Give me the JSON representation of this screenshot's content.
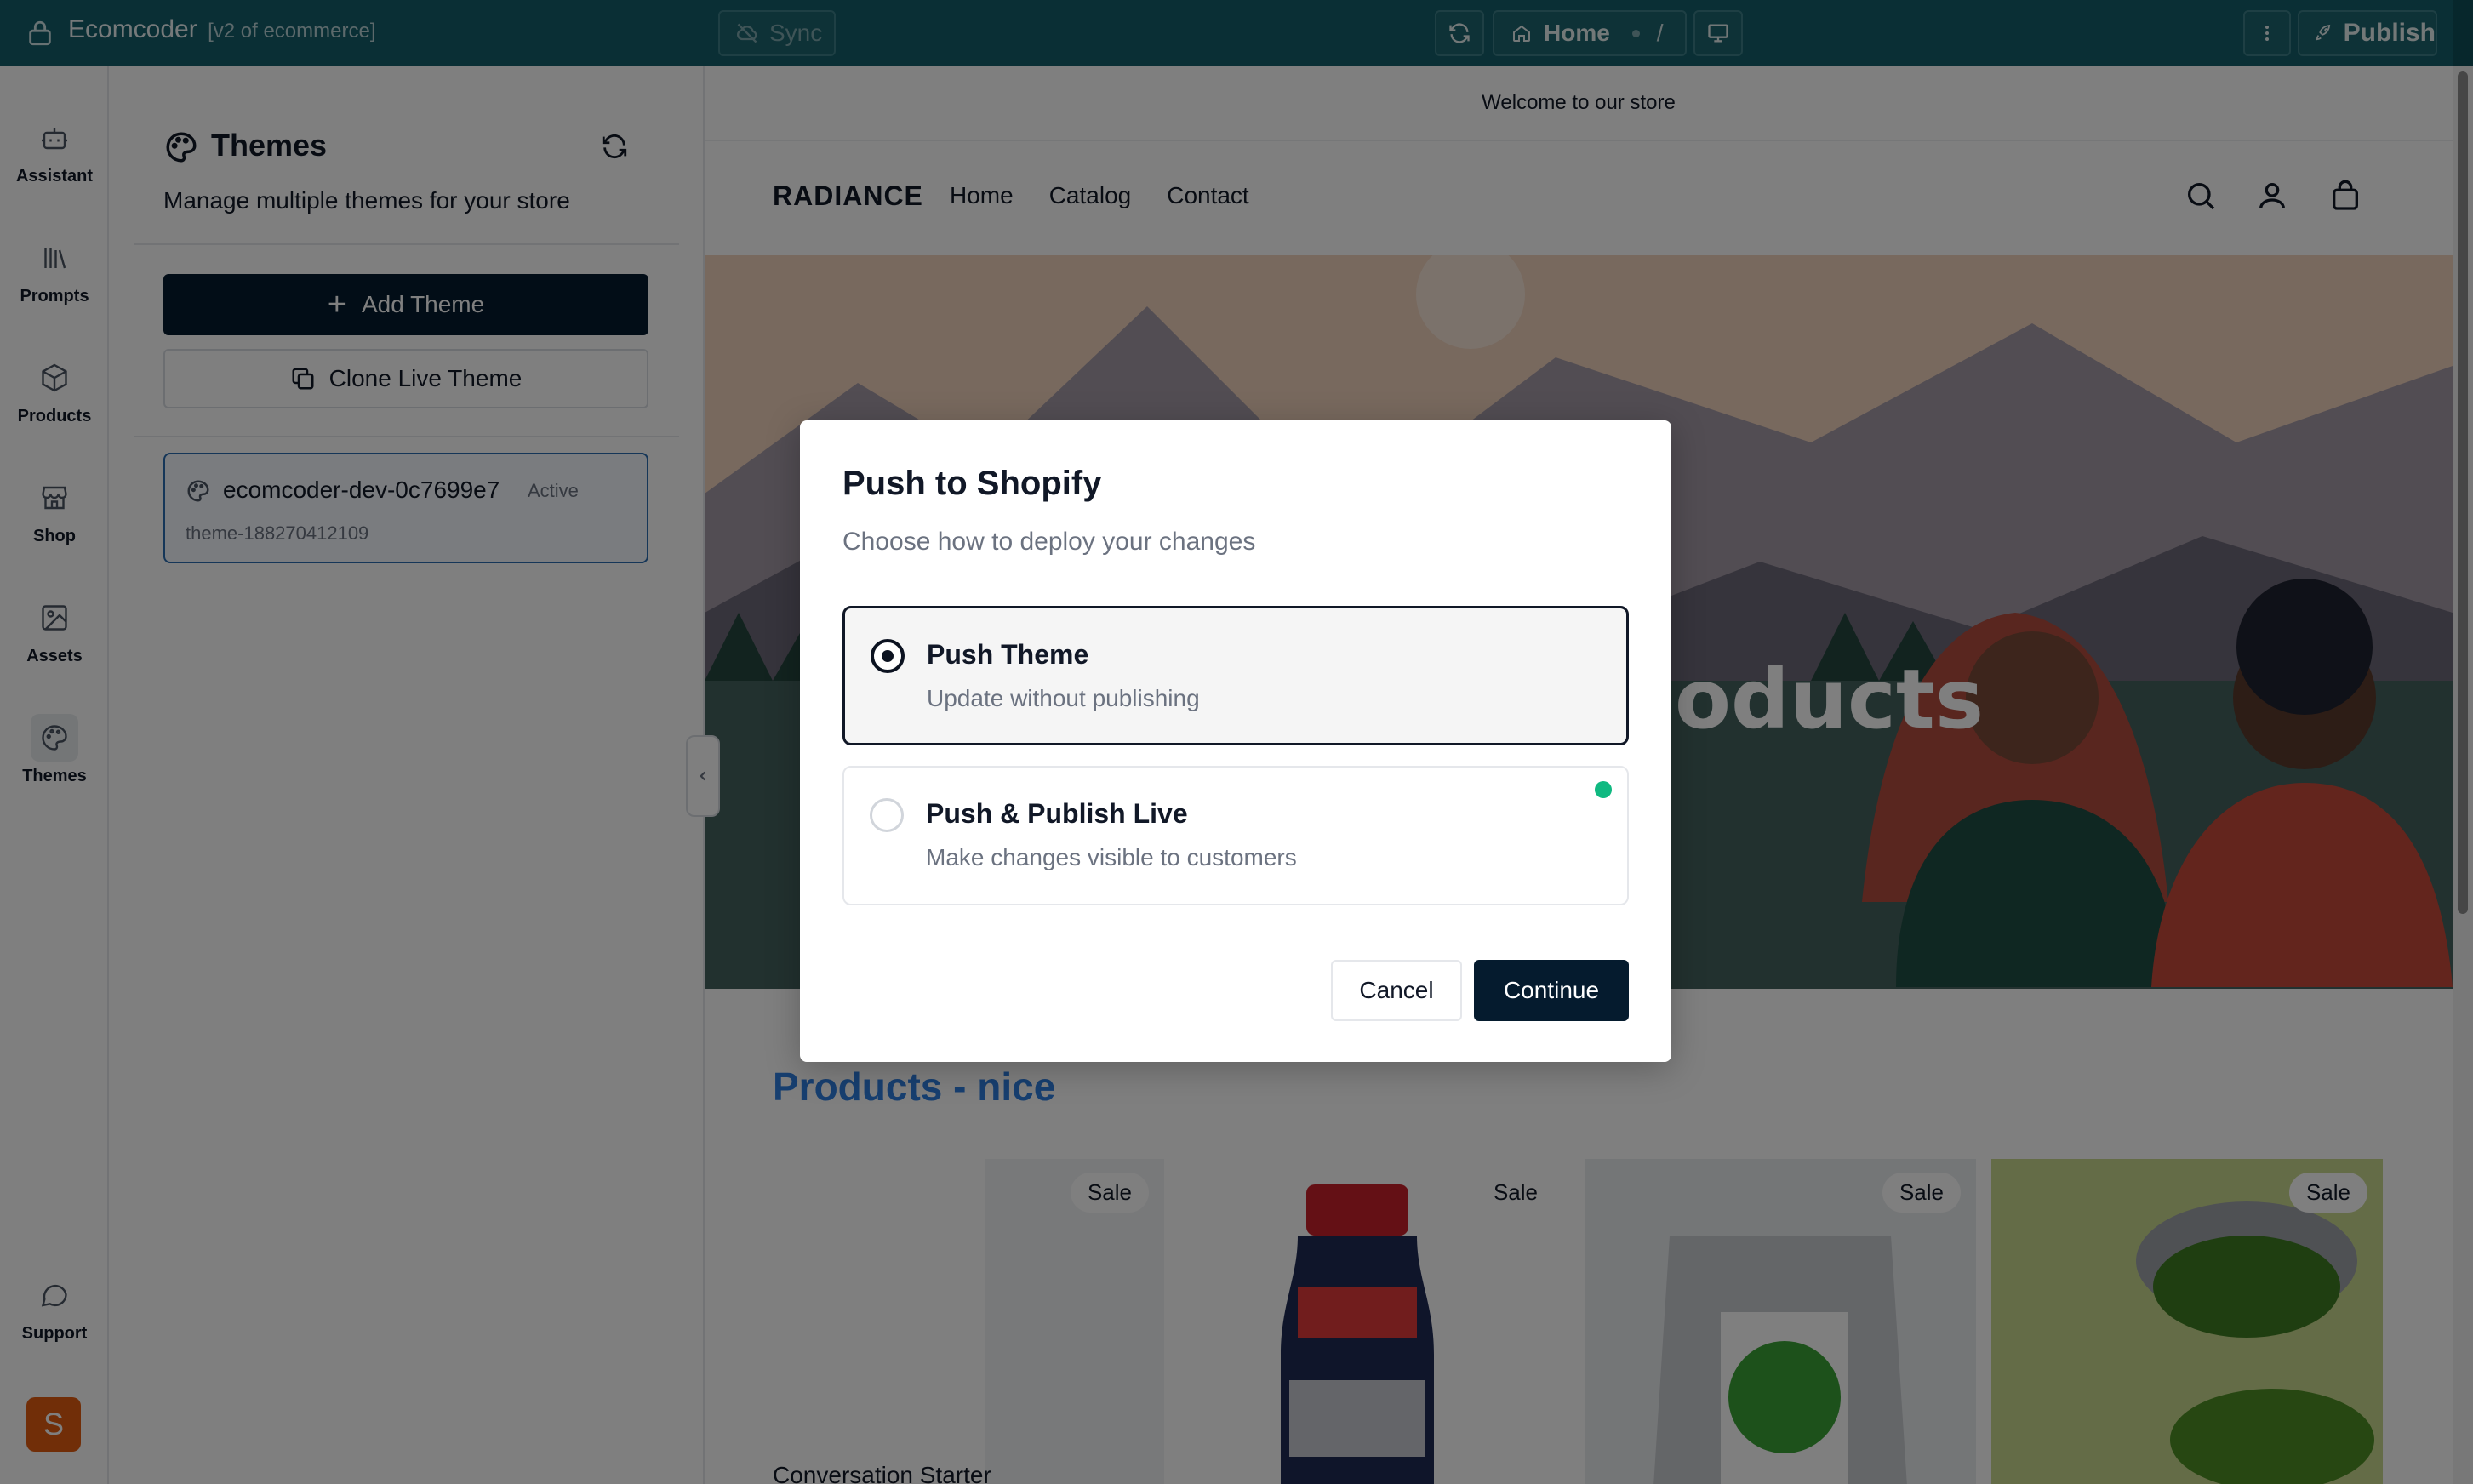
{
  "topbar": {
    "app_name": "Ecomcoder",
    "project": "[v2 of ecommerce]",
    "sync_label": "Sync",
    "route_label": "Home",
    "route_path": "/",
    "publish_label": "Publish"
  },
  "rail": {
    "items": [
      {
        "label": "Assistant",
        "icon": "robot-icon"
      },
      {
        "label": "Prompts",
        "icon": "library-icon"
      },
      {
        "label": "Products",
        "icon": "package-icon"
      },
      {
        "label": "Shop",
        "icon": "store-icon"
      },
      {
        "label": "Assets",
        "icon": "image-icon"
      },
      {
        "label": "Themes",
        "icon": "palette-icon",
        "active": true
      }
    ],
    "support_label": "Support",
    "avatar_initial": "S"
  },
  "themes_panel": {
    "title": "Themes",
    "description": "Manage multiple themes for your store",
    "add_label": "Add Theme",
    "clone_label": "Clone Live Theme",
    "themes": [
      {
        "name": "ecomcoder-dev-0c7699e7",
        "status": "Active",
        "id": "theme-188270412109"
      }
    ]
  },
  "storefront": {
    "announcement": "Welcome to our store",
    "brand": "RADIANCE",
    "nav": [
      "Home",
      "Catalog",
      "Contact"
    ],
    "hero_text": "oducts",
    "section_title": "Products - nice",
    "sale_badge": "Sale",
    "first_product_name": "Conversation Starter"
  },
  "modal": {
    "title": "Push to Shopify",
    "subtitle": "Choose how to deploy your changes",
    "options": [
      {
        "title": "Push Theme",
        "desc": "Update without publishing",
        "selected": true
      },
      {
        "title": "Push & Publish Live",
        "desc": "Make changes visible to customers",
        "selected": false
      }
    ],
    "cancel_label": "Cancel",
    "continue_label": "Continue"
  },
  "colors": {
    "topbar": "#145f6a",
    "primary_button": "#051b2e",
    "accent_blue": "#2f7fe0",
    "live_dot": "#10b981"
  }
}
